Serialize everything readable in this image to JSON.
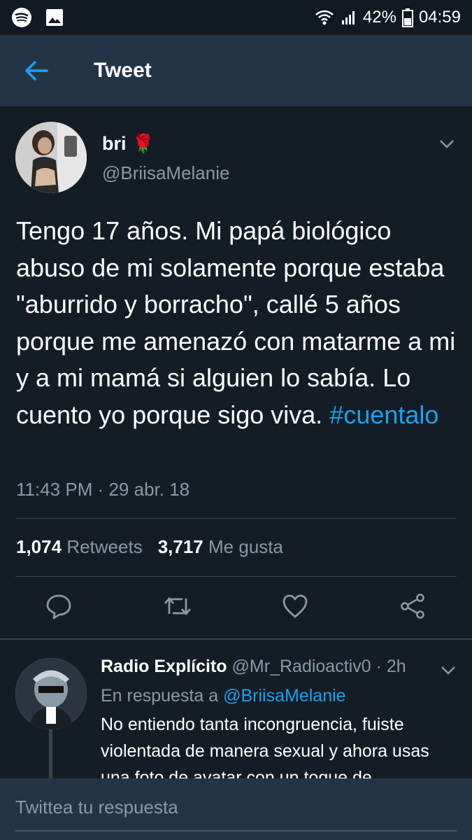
{
  "status_bar": {
    "battery": "42%",
    "time": "04:59",
    "icons": [
      "spotify-icon",
      "gallery-icon",
      "wifi-icon",
      "signal-icon",
      "battery-icon"
    ]
  },
  "header": {
    "title": "Tweet",
    "back_icon": "arrow-left-icon"
  },
  "tweet": {
    "display_name": "bri",
    "name_emoji": "🌹",
    "handle": "@BriisaMelanie",
    "text": "Tengo 17 años. Mi papá biológico abuso de mi solamente porque estaba \"aburrido y borracho\", callé 5 años porque me amenazó con matarme a mi y a mi mamá si alguien lo sabía. Lo cuento yo porque sigo viva.",
    "hashtag": "#cuentalo",
    "timestamp": "11:43 PM · 29 abr. 18",
    "retweets_count": "1,074",
    "retweets_label": "Retweets",
    "likes_count": "3,717",
    "likes_label": "Me gusta"
  },
  "reply": {
    "name": "Radio Explícito",
    "handle_time": "@Mr_Radioactiv0 · 2h",
    "in_reply_prefix": "En respuesta a",
    "in_reply_mention": "@BriisaMelanie",
    "text": "No entiendo tanta incongruencia, fuiste violentada de manera sexual y ahora usas una foto de avatar con un toque de"
  },
  "compose": {
    "placeholder": "Twittea tu respuesta"
  },
  "colors": {
    "background": "#141d26",
    "header": "#243447",
    "accent": "#1da1f2",
    "muted": "#8899a6",
    "divider": "#38444d"
  }
}
